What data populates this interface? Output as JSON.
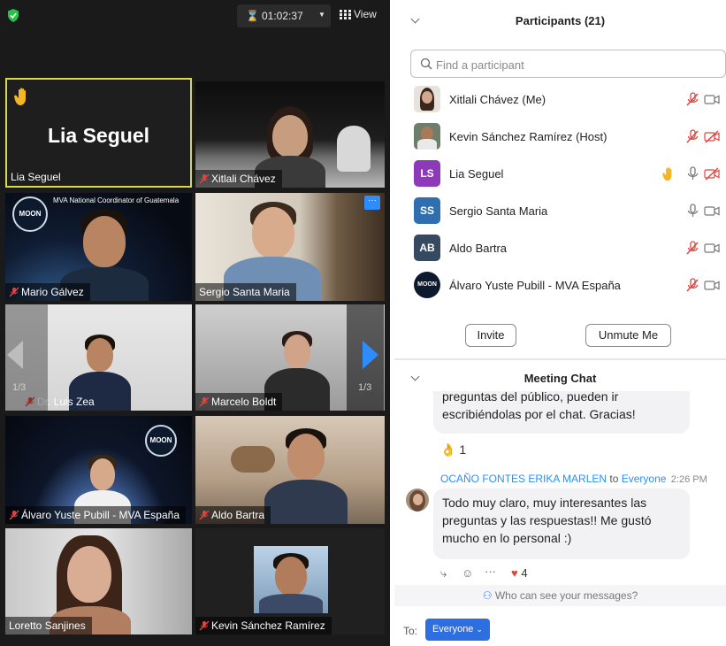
{
  "toolbar": {
    "timer": "01:02:37",
    "view_label": "View"
  },
  "gallery": {
    "page_left": "1/3",
    "page_right": "1/3",
    "coordinator_banner": "MVA National Coordinator of Guatemala",
    "logo_text": "MOON",
    "tiles": [
      {
        "name": "Lia Seguel",
        "big_name": "Lia Seguel"
      },
      {
        "name": "Xitlali Chávez"
      },
      {
        "name": "Mario Gálvez"
      },
      {
        "name": "Sergio Santa Maria"
      },
      {
        "name": "Dr. Luis Zea"
      },
      {
        "name": "Marcelo Boldt"
      },
      {
        "name": "Álvaro Yuste Pubill - MVA España"
      },
      {
        "name": "Aldo Bartra"
      },
      {
        "name": "Loretto Sanjines"
      },
      {
        "name": "Kevin Sánchez Ramírez"
      }
    ]
  },
  "participants": {
    "title": "Participants (21)",
    "search_placeholder": "Find a participant",
    "list": [
      {
        "name": "Xitlali Chávez (Me)",
        "avatar": "photo"
      },
      {
        "name": "Kevin Sánchez Ramírez (Host)",
        "avatar": "photo"
      },
      {
        "name": "Lia Seguel",
        "initials": "LS",
        "color": "#8e3ab8"
      },
      {
        "name": "Sergio Santa Maria",
        "initials": "SS",
        "color": "#2f6fb0"
      },
      {
        "name": "Aldo Bartra",
        "initials": "AB",
        "color": "#354a61"
      },
      {
        "name": "Álvaro Yuste Pubill - MVA España",
        "avatar": "logo"
      }
    ],
    "invite_label": "Invite",
    "unmute_label": "Unmute Me"
  },
  "chat": {
    "title": "Meeting Chat",
    "prev_message_line1": "preguntas del público, pueden ir",
    "prev_message_line2": "escribiéndolas por el chat. Gracias!",
    "prev_reaction_count": "1",
    "sender": "OCAÑO FONTES ERIKA MARLEN",
    "to_word": "to",
    "recipient": "Everyone",
    "time": "2:26 PM",
    "message_line1": "Todo muy claro, muy interesantes las",
    "message_line2": "preguntas y las respuestas!! Me gustó",
    "message_line3": "mucho en lo personal :)",
    "heart_count": "4",
    "who_can_see": "Who can see your messages?",
    "to_label": "To:",
    "recipient_button": "Everyone"
  },
  "colors": {
    "accent": "#2d8cff",
    "mute_red": "#e0443e",
    "active_border": "#d7d94a"
  }
}
